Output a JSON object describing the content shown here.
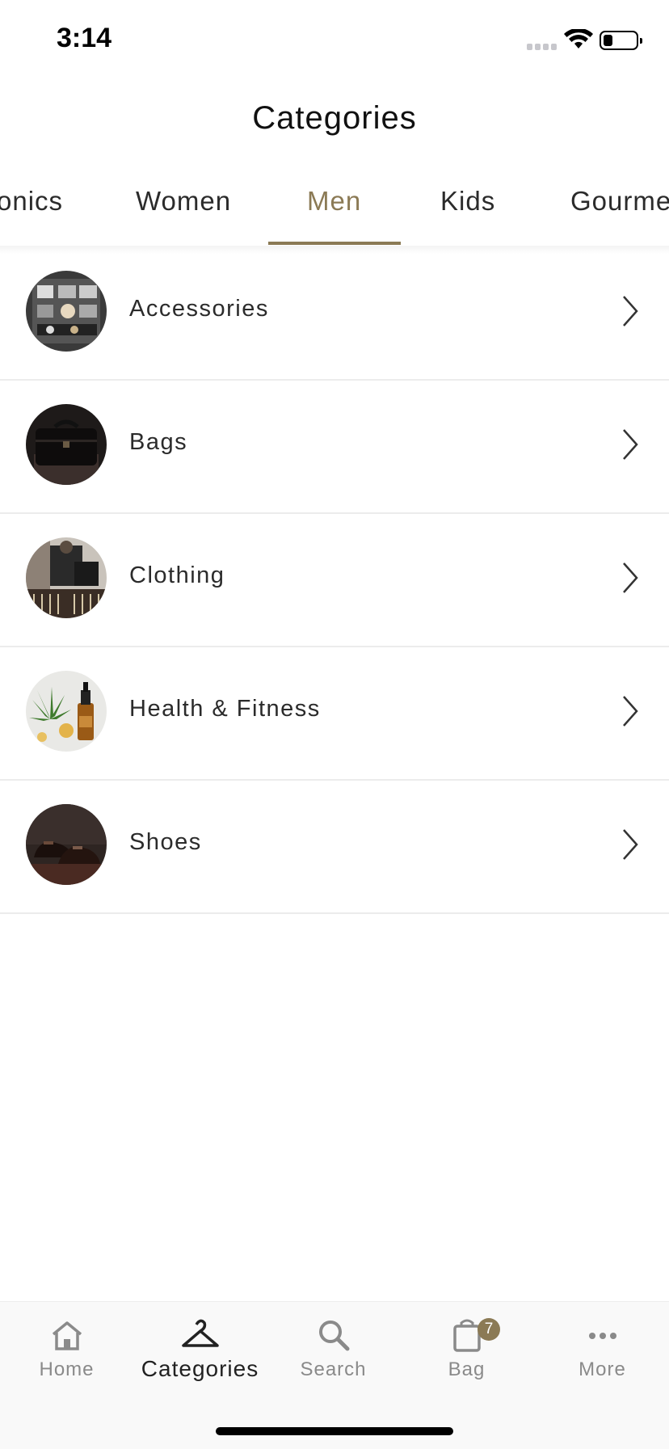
{
  "status_bar": {
    "time": "3:14",
    "battery_level": 0.3
  },
  "header": {
    "title": "Categories"
  },
  "tabs": [
    {
      "label": "onics"
    },
    {
      "label": "Women"
    },
    {
      "label": "Men",
      "active": true
    },
    {
      "label": "Kids"
    },
    {
      "label": "Gourme"
    }
  ],
  "categories": [
    {
      "label": "Accessories",
      "icon": "chevron-right-icon"
    },
    {
      "label": "Bags",
      "icon": "chevron-right-icon"
    },
    {
      "label": "Clothing",
      "icon": "chevron-right-icon"
    },
    {
      "label": "Health & Fitness",
      "icon": "chevron-right-icon"
    },
    {
      "label": "Shoes",
      "icon": "chevron-right-icon"
    }
  ],
  "tabbar": {
    "items": [
      {
        "label": "Home",
        "icon": "home-icon"
      },
      {
        "label": "Categories",
        "icon": "hanger-icon",
        "active": true
      },
      {
        "label": "Search",
        "icon": "search-icon"
      },
      {
        "label": "Bag",
        "icon": "shopping-bag-icon",
        "badge": "7"
      },
      {
        "label": "More",
        "icon": "more-dots-icon"
      }
    ]
  },
  "colors": {
    "accent": "#8b7a55",
    "text": "#2b2b2b",
    "inactive": "#8a8a8a"
  }
}
